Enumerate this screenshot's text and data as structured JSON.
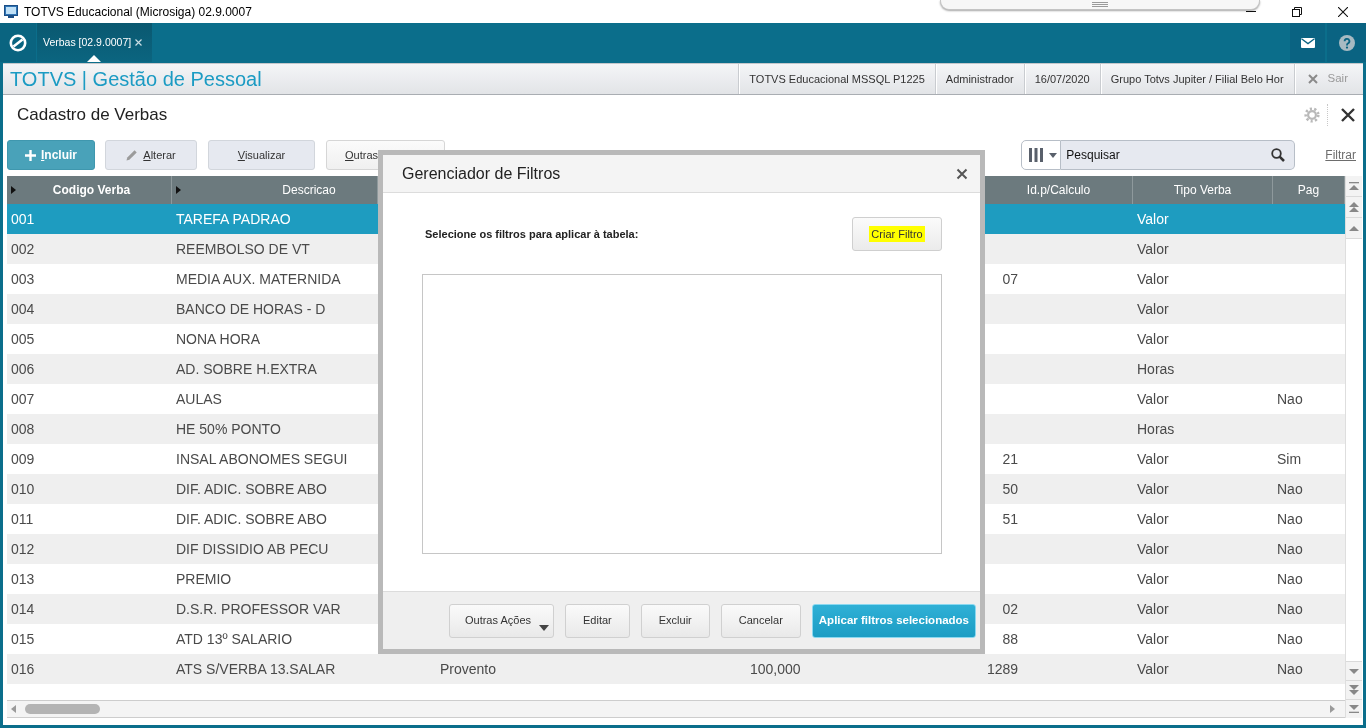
{
  "window": {
    "title": "TOTVS Educacional (Microsiga) 02.9.0007"
  },
  "tabs": [
    {
      "label": "Verbas [02.9.0007]",
      "selected": true
    }
  ],
  "header": {
    "product": "TOTVS | Gestão de Pessoal",
    "info": [
      "TOTVS Educacional MSSQL P1225",
      "Administrador",
      "16/07/2020",
      "Grupo Totvs Jupiter / Filial Belo Hor"
    ],
    "exit": "Sair"
  },
  "page": {
    "title": "Cadastro de Verbas"
  },
  "toolbar": {
    "buttons": [
      {
        "label": "Incluir",
        "kind": "primary",
        "mnemonic": true
      },
      {
        "label": "Alterar",
        "kind": "edit",
        "mnemonic": true
      },
      {
        "label": "Visualizar",
        "kind": "plain",
        "mnemonic": true
      },
      {
        "label": "Outras",
        "kind": "menu",
        "mnemonic": true
      }
    ],
    "search": {
      "placeholder": "Pesquisar"
    },
    "filter_link": "Filtrar"
  },
  "table": {
    "columns": [
      {
        "label": "Codigo Verba",
        "bold": true,
        "expander": true
      },
      {
        "label": "Descricao",
        "bold": false,
        "expander": true
      },
      null,
      null,
      {
        "label": "Id.p/Calculo",
        "bold": false,
        "expander": false
      },
      {
        "label": "Tipo Verba",
        "bold": false,
        "expander": false
      },
      {
        "label": "Pag",
        "bold": false,
        "expander": false
      }
    ],
    "rows": [
      {
        "cells": [
          "001",
          "TAREFA PADRAO",
          null,
          null,
          null,
          "Valor",
          null
        ],
        "selected": true
      },
      {
        "cells": [
          "002",
          "REEMBOLSO DE VT",
          null,
          null,
          null,
          "Valor",
          null
        ],
        "selected": false
      },
      {
        "cells": [
          "003",
          "MEDIA AUX. MATERNIDA",
          null,
          null,
          "07",
          "Valor",
          null
        ],
        "selected": false
      },
      {
        "cells": [
          "004",
          "BANCO DE HORAS - D",
          null,
          null,
          null,
          "Valor",
          null
        ],
        "selected": false
      },
      {
        "cells": [
          "005",
          "NONA HORA",
          null,
          null,
          null,
          "Valor",
          null
        ],
        "selected": false
      },
      {
        "cells": [
          "006",
          "AD. SOBRE H.EXTRA",
          null,
          null,
          null,
          "Horas",
          null
        ],
        "selected": false
      },
      {
        "cells": [
          "007",
          "AULAS",
          null,
          null,
          null,
          "Valor",
          "Nao"
        ],
        "selected": false
      },
      {
        "cells": [
          "008",
          "HE 50% PONTO",
          null,
          null,
          null,
          "Horas",
          null
        ],
        "selected": false
      },
      {
        "cells": [
          "009",
          "INSAL ABONOMES SEGUI",
          null,
          null,
          "21",
          "Valor",
          "Sim"
        ],
        "selected": false
      },
      {
        "cells": [
          "010",
          "DIF. ADIC. SOBRE ABO",
          null,
          null,
          "50",
          "Valor",
          "Nao"
        ],
        "selected": false
      },
      {
        "cells": [
          "011",
          "DIF. ADIC. SOBRE ABO",
          null,
          null,
          "51",
          "Valor",
          "Nao"
        ],
        "selected": false
      },
      {
        "cells": [
          "012",
          "DIF DISSIDIO AB PECU",
          null,
          null,
          null,
          "Valor",
          "Nao"
        ],
        "selected": false
      },
      {
        "cells": [
          "013",
          "PREMIO",
          null,
          null,
          null,
          "Valor",
          "Nao"
        ],
        "selected": false
      },
      {
        "cells": [
          "014",
          "D.S.R. PROFESSOR VAR",
          null,
          null,
          "02",
          "Valor",
          "Nao"
        ],
        "selected": false
      },
      {
        "cells": [
          "015",
          "ATD 13º SALARIO",
          null,
          null,
          "88",
          "Valor",
          "Nao"
        ],
        "selected": false
      },
      {
        "cells": [
          "016",
          "ATS S/VERBA 13.SALAR",
          "Provento",
          "100,000",
          "1289",
          "Valor",
          "Nao"
        ],
        "selected": false
      }
    ]
  },
  "dialog": {
    "title": "Gerenciador de Filtros",
    "prompt": "Selecione os filtros para aplicar à tabela:",
    "create_button": {
      "label": "Criar Filtro",
      "highlighted": true
    },
    "buttons": [
      {
        "label": "Outras Ações",
        "kind": "dropdown"
      },
      {
        "label": "Editar",
        "kind": "default"
      },
      {
        "label": "Excluir",
        "kind": "default"
      },
      {
        "label": "Cancelar",
        "kind": "default"
      },
      {
        "label": "Aplicar filtros selecionados",
        "kind": "primary"
      }
    ]
  }
}
